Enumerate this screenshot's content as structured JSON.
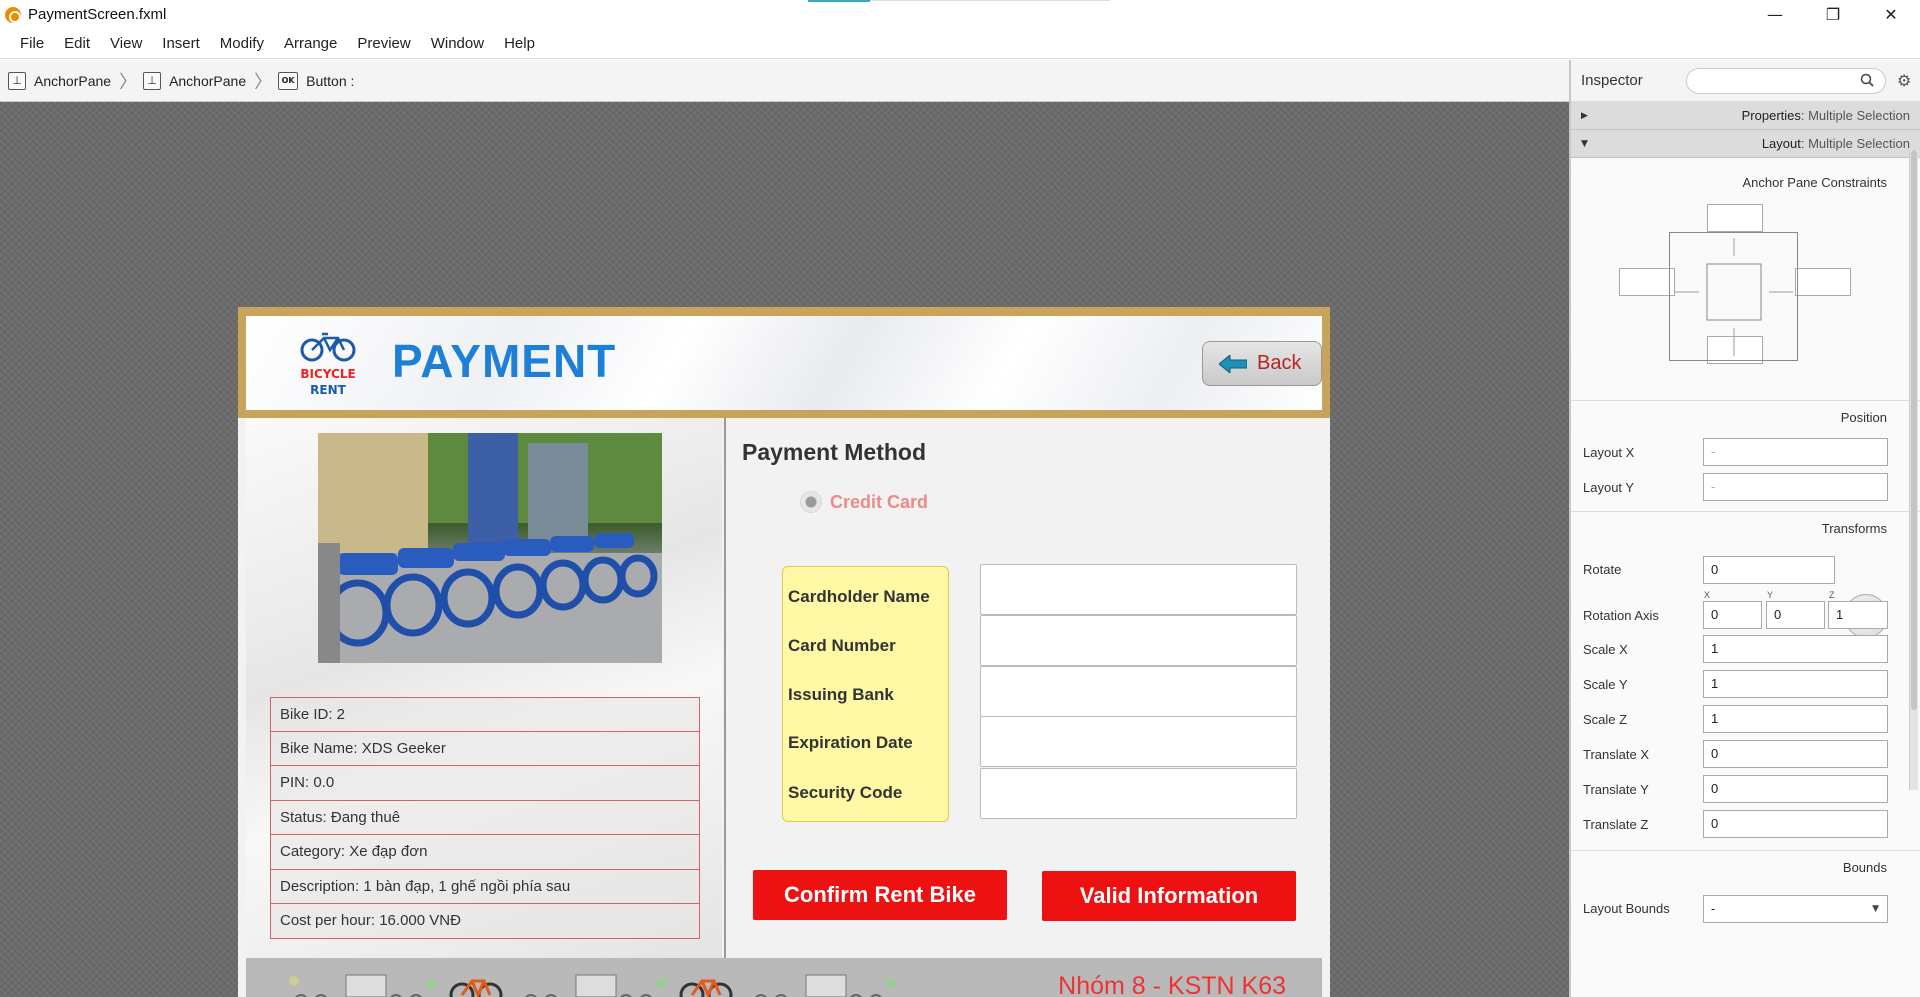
{
  "window": {
    "title": "PaymentScreen.fxml",
    "minimize": "—",
    "restore": "❐",
    "close": "✕"
  },
  "menu": [
    "File",
    "Edit",
    "View",
    "Insert",
    "Modify",
    "Arrange",
    "Preview",
    "Window",
    "Help"
  ],
  "breadcrumb": [
    {
      "label": "AnchorPane",
      "icon": "anchor-pane-icon"
    },
    {
      "label": "AnchorPane",
      "icon": "anchor-pane-icon"
    },
    {
      "label": "Button :",
      "icon": "button-ok-icon"
    }
  ],
  "form": {
    "logo_text_top": "BICYCLE",
    "logo_text_bottom": "RENT",
    "title": "PAYMENT",
    "back_label": "Back",
    "payment_method_title": "Payment Method",
    "radio_label": "Credit Card",
    "fields": [
      "Cardholder Name",
      "Card Number",
      "Issuing Bank",
      "Expiration Date",
      "Security Code"
    ],
    "bike_info": [
      "Bike ID: 2",
      "Bike Name: XDS Geeker",
      "PIN: 0.0",
      "Status: Đang thuê",
      "Category: Xe đạp đơn",
      "Description: 1 bàn đạp, 1 ghế ngồi phía sau",
      "Cost per hour: 16.000 VNĐ"
    ],
    "confirm_label": "Confirm Rent Bike",
    "valid_label": "Valid Information",
    "footer_text": "Nhóm 8 - KSTN K63"
  },
  "inspector": {
    "title": "Inspector",
    "properties_label": "Properties",
    "layout_label": "Layout",
    "selection_note": ": Multiple Selection",
    "anchor_constraints": "Anchor Pane Constraints",
    "position": "Position",
    "transforms": "Transforms",
    "bounds": "Bounds",
    "layout_x": {
      "label": "Layout X",
      "value": "-"
    },
    "layout_y": {
      "label": "Layout Y",
      "value": "-"
    },
    "rotate": {
      "label": "Rotate",
      "value": "0"
    },
    "rotation_axis": {
      "label": "Rotation Axis",
      "x": "0",
      "y": "0",
      "z": "1",
      "xl": "X",
      "yl": "Y",
      "zl": "Z"
    },
    "scale_x": {
      "label": "Scale X",
      "value": "1"
    },
    "scale_y": {
      "label": "Scale Y",
      "value": "1"
    },
    "scale_z": {
      "label": "Scale Z",
      "value": "1"
    },
    "translate_x": {
      "label": "Translate X",
      "value": "0"
    },
    "translate_y": {
      "label": "Translate Y",
      "value": "0"
    },
    "translate_z": {
      "label": "Translate Z",
      "value": "0"
    },
    "layout_bounds": {
      "label": "Layout Bounds",
      "value": "-"
    }
  },
  "colors": {
    "accent_title": "#1e7fd6",
    "button_red": "#ee1111",
    "label_box": "#fff9a6",
    "header_frame": "#c8a35a"
  }
}
